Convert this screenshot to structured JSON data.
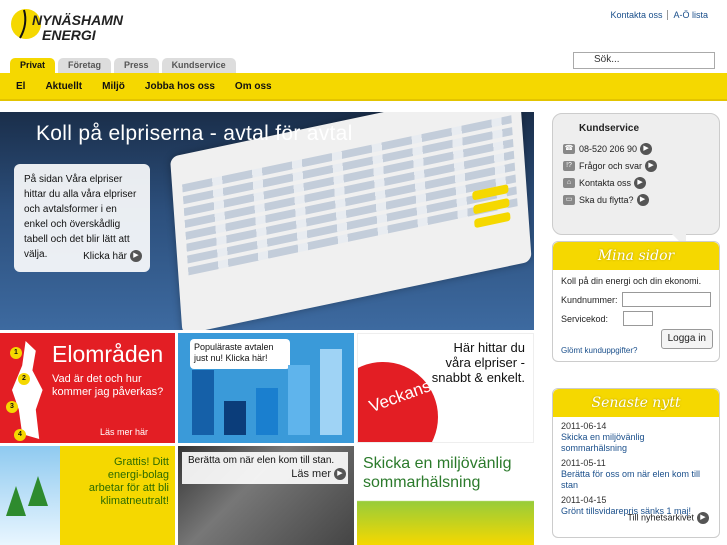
{
  "brand": {
    "logo_line1": "NYNÄSHAMN",
    "logo_line2": "ENERGI",
    "yellow": "#f5d800",
    "red": "#e31e24"
  },
  "toplinks": {
    "contact": "Kontakta oss",
    "az": "A-Ö lista"
  },
  "search": {
    "placeholder": "Sök..."
  },
  "tabs": [
    "Privat",
    "Företag",
    "Press",
    "Kundservice"
  ],
  "mainnav": [
    "El",
    "Aktuellt",
    "Miljö",
    "Jobba hos oss",
    "Om oss"
  ],
  "hero": {
    "title": "Koll på elpriserna - avtal för avtal",
    "body": "På sidan Våra elpriser hittar du alla våra elpriser och avtalsformer i en enkel och överskådlig tabell och det blir lätt att välja.",
    "cta": "Klicka här"
  },
  "tiles": {
    "elomraden": {
      "heading": "Elområden",
      "text": "Vad är det och hur kommer jag påverkas?",
      "more": "Läs mer här",
      "numbers": [
        "1",
        "2",
        "3",
        "4"
      ]
    },
    "popular": {
      "bubble": "Populäraste avtalen just nu! Klicka här!",
      "bars": [
        0.72,
        0.38,
        0.52,
        0.78,
        0.95
      ]
    },
    "veckans": {
      "text": "Här hittar du våra elpriser - snabbt & enkelt.",
      "badge": "Veckans Elpriser"
    },
    "gratis": {
      "text": "Grattis! Ditt energi-bolag arbetar för att bli klimatneutralt!"
    },
    "berätta": {
      "text": "Berätta om när elen kom till stan.",
      "more": "Läs mer"
    },
    "halsning": {
      "text": "Skicka en miljövänlig sommarhälsning"
    }
  },
  "kundservice": {
    "title": "Kundservice",
    "items": [
      {
        "icon": "phone-icon",
        "label": "08-520 206 90"
      },
      {
        "icon": "question-icon",
        "label": "Frågor och svar"
      },
      {
        "icon": "house-icon",
        "label": "Kontakta oss"
      },
      {
        "icon": "truck-icon",
        "label": "Ska du flytta?"
      }
    ]
  },
  "minasidor": {
    "title": "Mina sidor",
    "desc": "Koll på din energi och din ekonomi.",
    "customer_label": "Kundnummer:",
    "code_label": "Servicekod:",
    "login": "Logga in",
    "forgot": "Glömt kunduppgifter?"
  },
  "news": {
    "title": "Senaste nytt",
    "items": [
      {
        "date": "2011-06-14",
        "text": "Skicka en miljövänlig sommarhälsning"
      },
      {
        "date": "2011-05-11",
        "text": "Berätta för oss om när elen kom till stan"
      },
      {
        "date": "2011-04-15",
        "text": "Grönt tillsvidarepris sänks 1 maj!"
      }
    ],
    "archive": "Till nyhetsarkivet"
  }
}
